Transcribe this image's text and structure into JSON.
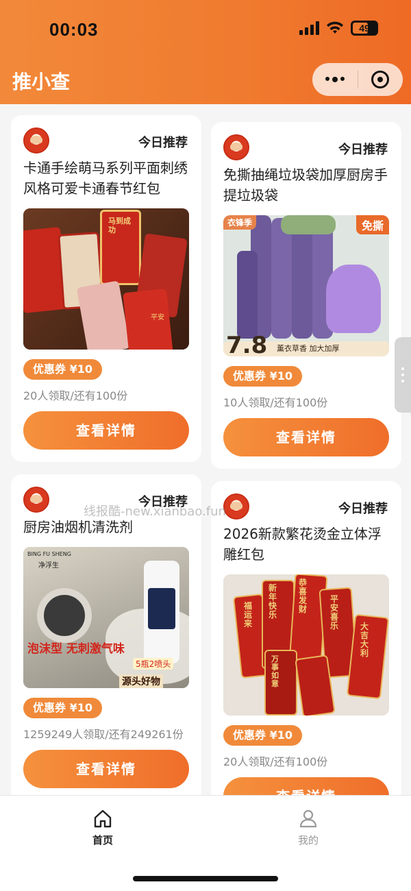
{
  "status_bar": {
    "time": "00:03",
    "battery": "49"
  },
  "header": {
    "title": "推小查"
  },
  "cards": [
    {
      "label": "今日推荐",
      "title": "卡通手绘萌马系列平面刺绣风格可爱卡通春节红包",
      "coupon": "优惠券 ¥10",
      "stock": "20人领取/还有100份",
      "button": "查看详情",
      "image_text": [
        "马到成功",
        "平安"
      ]
    },
    {
      "label": "今日推荐",
      "title": "免撕抽绳垃圾袋加厚厨房手提垃圾袋",
      "coupon": "优惠券 ¥10",
      "stock": "10人领取/还有100份",
      "button": "查看详情",
      "image_text": [
        "衣锋季",
        "免撕",
        "7.8",
        "薰衣草香 加大加厚"
      ]
    },
    {
      "label": "今日推荐",
      "title": "厨房油烟机清洗剂",
      "coupon": "优惠券 ¥10",
      "stock": "1259249人领取/还有249261份",
      "button": "查看详情",
      "image_text": [
        "BING FU SHENG",
        "净浮生",
        "泡沫型 无刺激气味",
        "5瓶2喷头",
        "源头好物"
      ]
    },
    {
      "label": "今日推荐",
      "title": "2026新款繁花烫金立体浮雕红包",
      "coupon": "优惠券 ¥10",
      "stock": "20人领取/还有100份",
      "button": "查看详情",
      "image_text": [
        "新年快乐",
        "恭喜发财",
        "大吉大利",
        "福运来",
        "万事如意",
        "平安喜乐"
      ]
    }
  ],
  "watermark": "线报酷-new.xianbao.fun",
  "tabbar": {
    "home": "首页",
    "me": "我的"
  },
  "colors": {
    "accent": "#f07a2f",
    "coupon": "#f08a3a",
    "active_tab": "#222222",
    "inactive_tab": "#999999"
  }
}
